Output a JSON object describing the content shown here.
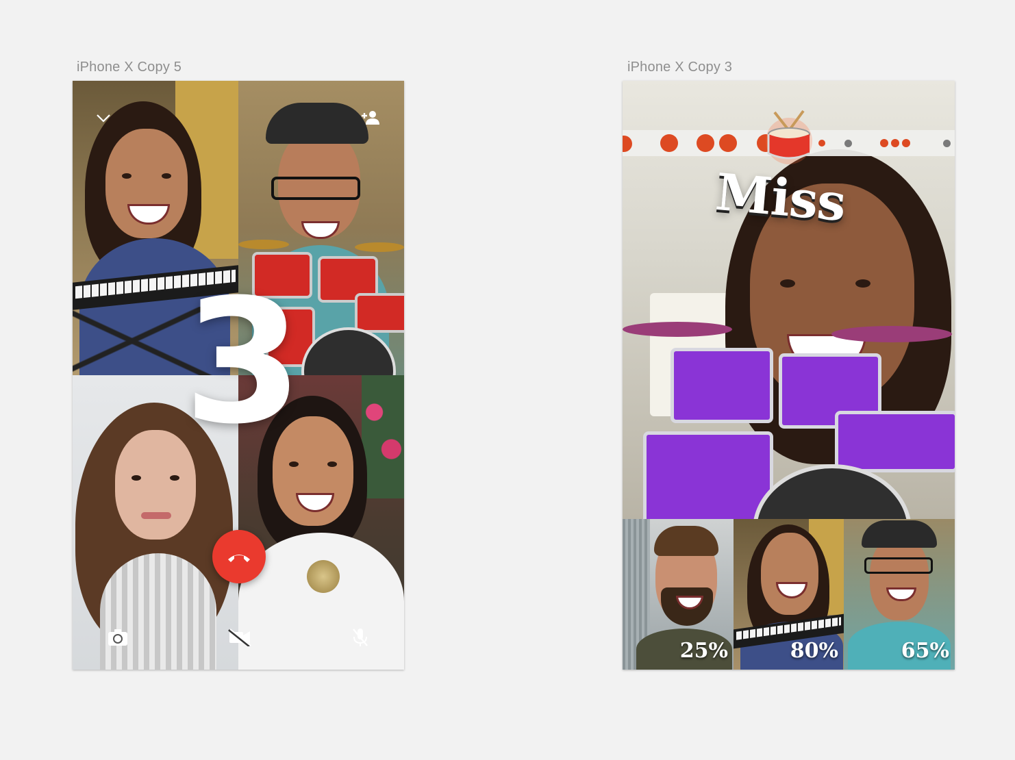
{
  "artboards": [
    {
      "label": "iPhone X Copy 5"
    },
    {
      "label": "iPhone X Copy 3"
    }
  ],
  "call": {
    "countdown": "3",
    "icons": {
      "collapse": "chevron-down-icon",
      "add_person": "add-person-icon",
      "end_call": "end-call-icon",
      "flip_camera": "flip-camera-icon",
      "video_off": "video-off-icon",
      "mic_off": "mic-off-icon"
    }
  },
  "game": {
    "feedback": "Miss",
    "participants": [
      {
        "score": "25%"
      },
      {
        "score": "80%"
      },
      {
        "score": "65%"
      }
    ],
    "colors": {
      "note": "#dd4a22",
      "inactive_note": "#7a7a7a",
      "drum_kit": "#8a34d6"
    }
  }
}
